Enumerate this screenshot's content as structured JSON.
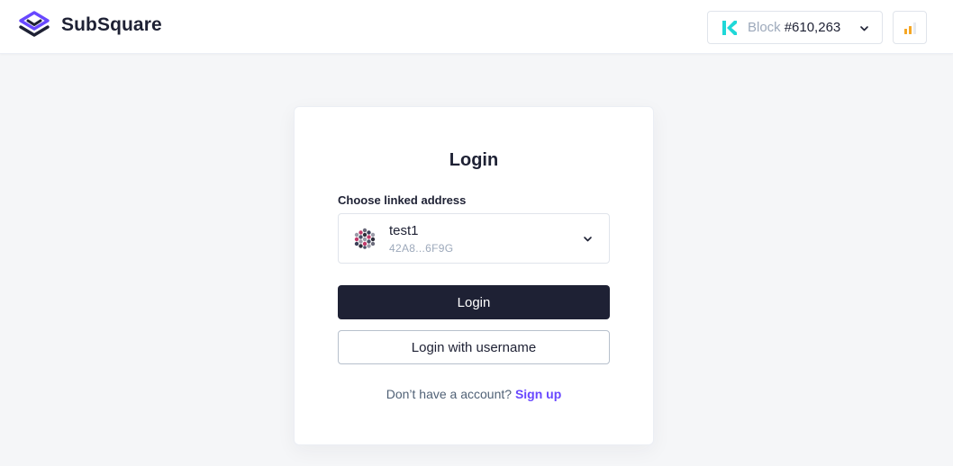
{
  "header": {
    "app_name": "SubSquare",
    "network": {
      "icon": "kintsugi-k-icon",
      "block_label": "Block",
      "block_number": "#610,263"
    },
    "signal_icon": "signal-bars-icon"
  },
  "login": {
    "title": "Login",
    "address_label": "Choose linked address",
    "selected_account": {
      "name": "test1",
      "address": "42A8...6F9G",
      "icon": "polkadot-identicon"
    },
    "login_button": "Login",
    "login_with_username_button": "Login with username",
    "no_account_text": "Don’t have a account?",
    "signup_link": "Sign up"
  },
  "colors": {
    "brand_purple": "#6848ff",
    "primary_dark": "#1e2134",
    "network_teal": "#1fd8d8",
    "signal_orange": "#f5a623",
    "background": "#f5f6f8"
  }
}
